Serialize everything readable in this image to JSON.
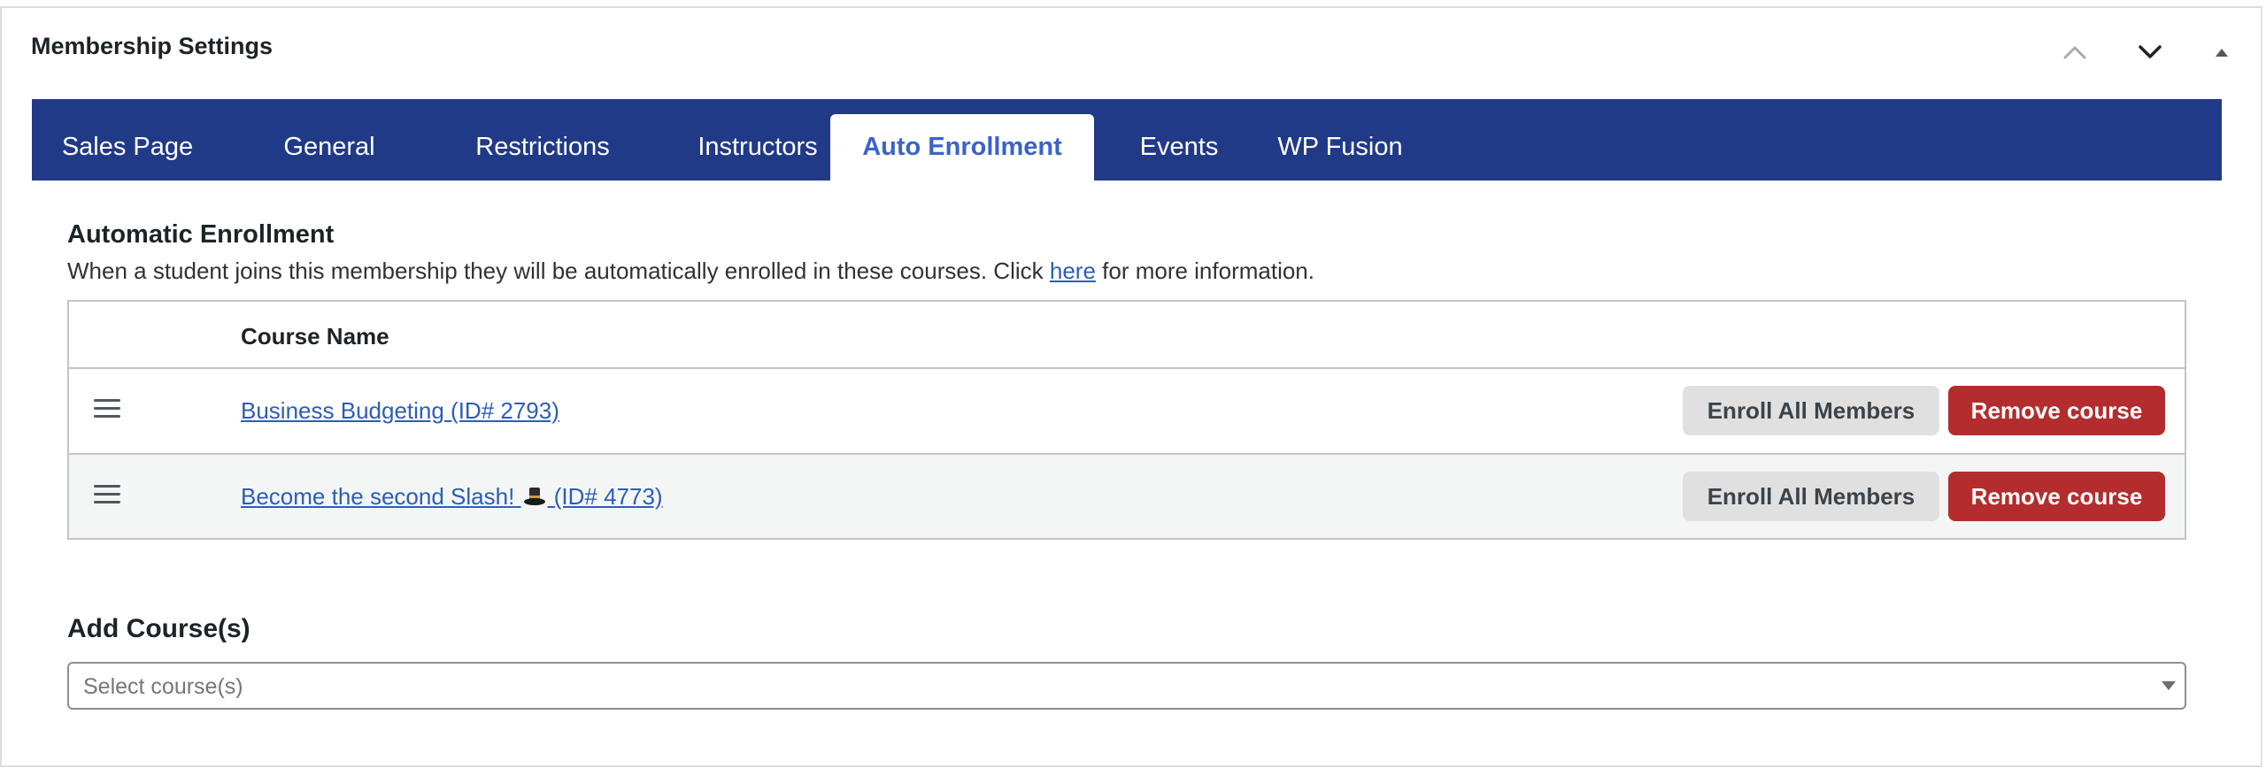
{
  "panel": {
    "title": "Membership Settings",
    "controls": [
      "chevron-up-icon",
      "chevron-down-icon",
      "toggle-triangle-icon"
    ]
  },
  "tabs": [
    {
      "label": "Sales Page",
      "active": false
    },
    {
      "label": "General",
      "active": false
    },
    {
      "label": "Restrictions",
      "active": false
    },
    {
      "label": "Instructors",
      "active": false
    },
    {
      "label": "Auto Enrollment",
      "active": true
    },
    {
      "label": "Events",
      "active": false
    },
    {
      "label": "WP Fusion",
      "active": false
    }
  ],
  "auto_enrollment": {
    "title": "Automatic Enrollment",
    "description_before": "When a student joins this membership they will be automatically enrolled in these courses. Click ",
    "description_link": "here",
    "description_after": " for more information.",
    "table": {
      "column_header": "Course Name",
      "rows": [
        {
          "course_before": "Business Budgeting (ID# 2793)",
          "course_after": "",
          "emoji": false
        },
        {
          "course_before": "Become the second Slash! ",
          "course_after": " (ID# 4773)",
          "emoji": true
        }
      ],
      "enroll_label": "Enroll All Members",
      "remove_label": "Remove course"
    }
  },
  "add_courses": {
    "title": "Add Course(s)",
    "placeholder": "Select course(s)"
  },
  "colors": {
    "tab_bar": "#213a88",
    "active_tab_text": "#3a63c9",
    "link": "#2c5db8",
    "remove_button": "#b32d2e",
    "enroll_button": "#e0e0e0"
  }
}
